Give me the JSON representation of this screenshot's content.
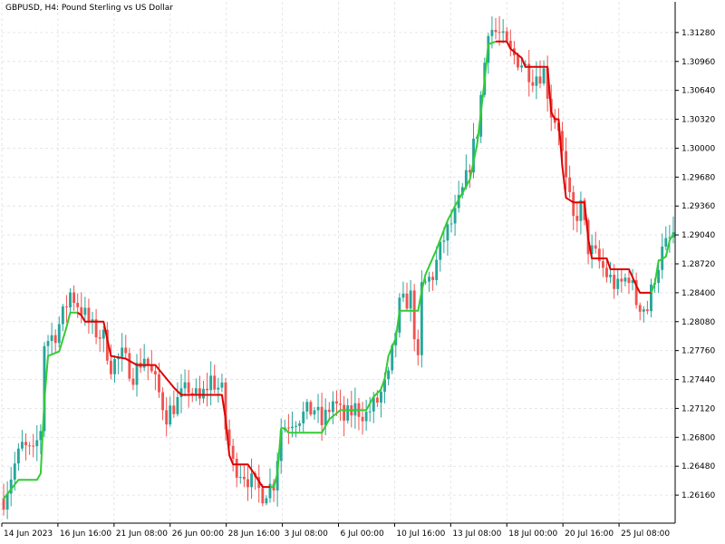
{
  "chart_data": {
    "type": "candlestick",
    "title": "GBPUSD, H4:  Pound Sterling vs US Dollar",
    "symbol": "GBPUSD",
    "timeframe": "H4",
    "description": "Pound Sterling vs US Dollar",
    "ylim": [
      1.2585,
      1.3162
    ],
    "y_ticks": [
      "1.31280",
      "1.30960",
      "1.30640",
      "1.30320",
      "1.30000",
      "1.29680",
      "1.29360",
      "1.29040",
      "1.28720",
      "1.28400",
      "1.28080",
      "1.27760",
      "1.27440",
      "1.27120",
      "1.26800",
      "1.26480",
      "1.26160"
    ],
    "x_tick_labels": [
      "14 Jun 2023",
      "16 Jun 16:00",
      "21 Jun 08:00",
      "26 Jun 00:00",
      "28 Jun 16:00",
      "3 Jul 08:00",
      "6 Jul 00:00",
      "10 Jul 16:00",
      "13 Jul 08:00",
      "18 Jul 00:00",
      "20 Jul 16:00",
      "25 Jul 08:00"
    ],
    "grid": true,
    "colors": {
      "bull": "#26a69a",
      "bear": "#ef5350",
      "trail_up": "#33cc33",
      "trail_down": "#dd0000",
      "grid": "#e6e6e6",
      "axis": "#000000"
    },
    "trail_anchors": [
      [
        0,
        1.2612
      ],
      [
        4,
        1.2633
      ],
      [
        9,
        1.2633
      ],
      [
        10,
        1.264
      ],
      [
        11,
        1.272
      ],
      [
        12,
        1.277
      ],
      [
        15,
        1.2775
      ],
      [
        17,
        1.2802
      ],
      [
        18,
        1.2818
      ],
      [
        20,
        1.2818
      ],
      [
        21,
        1.2815
      ],
      [
        22,
        1.2808
      ],
      [
        27,
        1.2808
      ],
      [
        29,
        1.277
      ],
      [
        33,
        1.2767
      ],
      [
        36,
        1.276
      ],
      [
        41,
        1.276
      ],
      [
        44,
        1.2745
      ],
      [
        46,
        1.2735
      ],
      [
        48,
        1.2727
      ],
      [
        59,
        1.2727
      ],
      [
        60,
        1.27
      ],
      [
        61,
        1.266
      ],
      [
        62,
        1.265
      ],
      [
        66,
        1.265
      ],
      [
        68,
        1.2638
      ],
      [
        70,
        1.2625
      ],
      [
        73,
        1.2625
      ],
      [
        74,
        1.264
      ],
      [
        75,
        1.269
      ],
      [
        76,
        1.269
      ],
      [
        77,
        1.2685
      ],
      [
        86,
        1.2685
      ],
      [
        88,
        1.27
      ],
      [
        91,
        1.271
      ],
      [
        98,
        1.271
      ],
      [
        100,
        1.2725
      ],
      [
        102,
        1.2733
      ],
      [
        103,
        1.2745
      ],
      [
        104,
        1.277
      ],
      [
        106,
        1.279
      ],
      [
        107,
        1.282
      ],
      [
        112,
        1.282
      ],
      [
        113,
        1.2842
      ],
      [
        114,
        1.286
      ],
      [
        117,
        1.2888
      ],
      [
        120,
        1.292
      ],
      [
        122,
        1.2936
      ],
      [
        126,
        1.2965
      ],
      [
        128,
        1.3005
      ],
      [
        130,
        1.3075
      ],
      [
        131,
        1.3115
      ],
      [
        133,
        1.3118
      ],
      [
        136,
        1.3118
      ],
      [
        137,
        1.311
      ],
      [
        140,
        1.31
      ],
      [
        141,
        1.309
      ],
      [
        147,
        1.309
      ],
      [
        148,
        1.304
      ],
      [
        149,
        1.3032
      ],
      [
        150,
        1.3032
      ],
      [
        151,
        1.298
      ],
      [
        152,
        1.2945
      ],
      [
        154,
        1.294
      ],
      [
        157,
        1.294
      ],
      [
        158,
        1.29
      ],
      [
        159,
        1.2878
      ],
      [
        163,
        1.2878
      ],
      [
        164,
        1.2866
      ],
      [
        169,
        1.2866
      ],
      [
        171,
        1.2848
      ],
      [
        172,
        1.284
      ],
      [
        175,
        1.284
      ],
      [
        176,
        1.285
      ],
      [
        177,
        1.2875
      ],
      [
        179,
        1.288
      ],
      [
        180,
        1.2898
      ],
      [
        181,
        1.2905
      ]
    ],
    "trail_direction_segments": [
      {
        "from": 0,
        "to": 19,
        "dir": "up"
      },
      {
        "from": 20,
        "to": 71,
        "dir": "down"
      },
      {
        "from": 72,
        "to": 132,
        "dir": "up"
      },
      {
        "from": 133,
        "to": 174,
        "dir": "down"
      },
      {
        "from": 175,
        "to": 181,
        "dir": "up"
      }
    ],
    "price_path": [
      [
        0,
        1.2612
      ],
      [
        3,
        1.265
      ],
      [
        5,
        1.267
      ],
      [
        8,
        1.266
      ],
      [
        10,
        1.269
      ],
      [
        11,
        1.2785
      ],
      [
        14,
        1.2795
      ],
      [
        16,
        1.2815
      ],
      [
        18,
        1.284
      ],
      [
        21,
        1.2822
      ],
      [
        24,
        1.28
      ],
      [
        27,
        1.279
      ],
      [
        29,
        1.276
      ],
      [
        32,
        1.277
      ],
      [
        35,
        1.275
      ],
      [
        38,
        1.277
      ],
      [
        41,
        1.274
      ],
      [
        44,
        1.2705
      ],
      [
        47,
        1.272
      ],
      [
        50,
        1.2735
      ],
      [
        53,
        1.272
      ],
      [
        56,
        1.2745
      ],
      [
        59,
        1.273
      ],
      [
        60,
        1.269
      ],
      [
        62,
        1.265
      ],
      [
        65,
        1.264
      ],
      [
        68,
        1.2625
      ],
      [
        70,
        1.2618
      ],
      [
        73,
        1.263
      ],
      [
        75,
        1.269
      ],
      [
        78,
        1.27
      ],
      [
        81,
        1.2705
      ],
      [
        84,
        1.2712
      ],
      [
        86,
        1.2695
      ],
      [
        89,
        1.272
      ],
      [
        92,
        1.27
      ],
      [
        95,
        1.2712
      ],
      [
        98,
        1.2705
      ],
      [
        101,
        1.272
      ],
      [
        104,
        1.2745
      ],
      [
        107,
        1.2825
      ],
      [
        110,
        1.2835
      ],
      [
        112,
        1.276
      ],
      [
        113,
        1.2845
      ],
      [
        116,
        1.286
      ],
      [
        119,
        1.29
      ],
      [
        122,
        1.2925
      ],
      [
        125,
        1.2965
      ],
      [
        128,
        1.302
      ],
      [
        130,
        1.3095
      ],
      [
        131,
        1.3135
      ],
      [
        134,
        1.3125
      ],
      [
        137,
        1.3105
      ],
      [
        140,
        1.3095
      ],
      [
        143,
        1.308
      ],
      [
        146,
        1.3085
      ],
      [
        148,
        1.304
      ],
      [
        150,
        1.3025
      ],
      [
        152,
        1.296
      ],
      [
        154,
        1.292
      ],
      [
        156,
        1.2935
      ],
      [
        158,
        1.289
      ],
      [
        160,
        1.288
      ],
      [
        163,
        1.286
      ],
      [
        166,
        1.2845
      ],
      [
        169,
        1.286
      ],
      [
        171,
        1.283
      ],
      [
        174,
        1.2822
      ],
      [
        176,
        1.286
      ],
      [
        178,
        1.2885
      ],
      [
        181,
        1.2905
      ]
    ]
  }
}
